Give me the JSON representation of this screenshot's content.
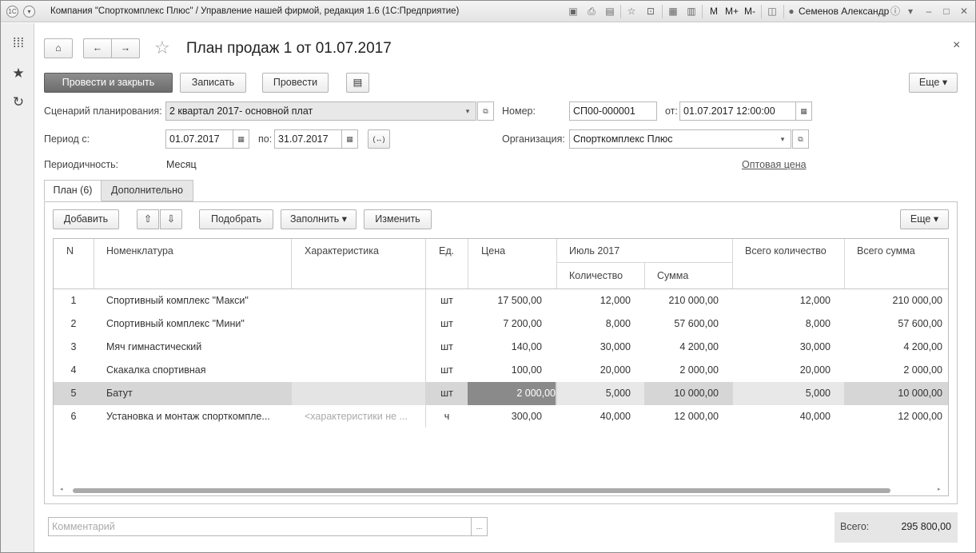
{
  "window": {
    "title": "Компания \"Спорткомплекс Плюс\" / Управление нашей фирмой, редакция 1.6  (1С:Предприятие)",
    "user": "Семенов Александр",
    "m_labels": [
      "M",
      "M+",
      "M-"
    ]
  },
  "document": {
    "title": "План продаж 1 от 01.07.2017",
    "close_glyph": "×"
  },
  "toolbar": {
    "post_close": "Провести и закрыть",
    "write": "Записать",
    "post": "Провести",
    "more": "Еще"
  },
  "form": {
    "scenario_label": "Сценарий планирования:",
    "scenario_value": "2 квартал 2017- основной плат",
    "number_label": "Номер:",
    "number_value": "СП00-000001",
    "from_label": "от:",
    "from_value": "01.07.2017 12:00:00",
    "period_label": "Период с:",
    "period_start": "01.07.2017",
    "period_to_label": "по:",
    "period_end": "31.07.2017",
    "period_btn": "(↔)",
    "org_label": "Организация:",
    "org_value": "Спорткомплекс Плюс",
    "periodicity_label": "Периодичность:",
    "periodicity_value": "Месяц",
    "price_link": "Оптовая цена"
  },
  "tabs": [
    "План (6)",
    "Дополнительно"
  ],
  "table_toolbar": {
    "add": "Добавить",
    "pick": "Подобрать",
    "fill": "Заполнить",
    "change": "Изменить",
    "more": "Еще"
  },
  "table": {
    "headers": {
      "n": "N",
      "item": "Номенклатура",
      "char": "Характеристика",
      "unit": "Ед.",
      "price": "Цена",
      "month": "Июль 2017",
      "qty": "Количество",
      "sum": "Сумма",
      "total_qty": "Всего количество",
      "total_sum": "Всего сумма"
    },
    "rows": [
      {
        "n": "1",
        "item": "Спортивный комплекс \"Макси\"",
        "char": "",
        "unit": "шт",
        "price": "17 500,00",
        "qty": "12,000",
        "sum": "210 000,00",
        "total_qty": "12,000",
        "total_sum": "210 000,00"
      },
      {
        "n": "2",
        "item": "Спортивный комплекс \"Мини\"",
        "char": "",
        "unit": "шт",
        "price": "7 200,00",
        "qty": "8,000",
        "sum": "57 600,00",
        "total_qty": "8,000",
        "total_sum": "57 600,00"
      },
      {
        "n": "3",
        "item": "Мяч гимнастический",
        "char": "",
        "unit": "шт",
        "price": "140,00",
        "qty": "30,000",
        "sum": "4 200,00",
        "total_qty": "30,000",
        "total_sum": "4 200,00"
      },
      {
        "n": "4",
        "item": "Скакалка спортивная",
        "char": "",
        "unit": "шт",
        "price": "100,00",
        "qty": "20,000",
        "sum": "2 000,00",
        "total_qty": "20,000",
        "total_sum": "2 000,00"
      },
      {
        "n": "5",
        "item": "Батут",
        "char": "",
        "unit": "шт",
        "price": "2 000,00",
        "qty": "5,000",
        "sum": "10 000,00",
        "total_qty": "5,000",
        "total_sum": "10 000,00"
      },
      {
        "n": "6",
        "item": "Установка и монтаж спорткомпле...",
        "char": "<характеристики не ...",
        "unit": "ч",
        "price": "300,00",
        "qty": "40,000",
        "sum": "12 000,00",
        "total_qty": "40,000",
        "total_sum": "12 000,00"
      }
    ],
    "selected_row": 5
  },
  "footer": {
    "comment_placeholder": "Комментарий",
    "comment_btn": "...",
    "total_label": "Всего:",
    "total_value": "295 800,00"
  }
}
